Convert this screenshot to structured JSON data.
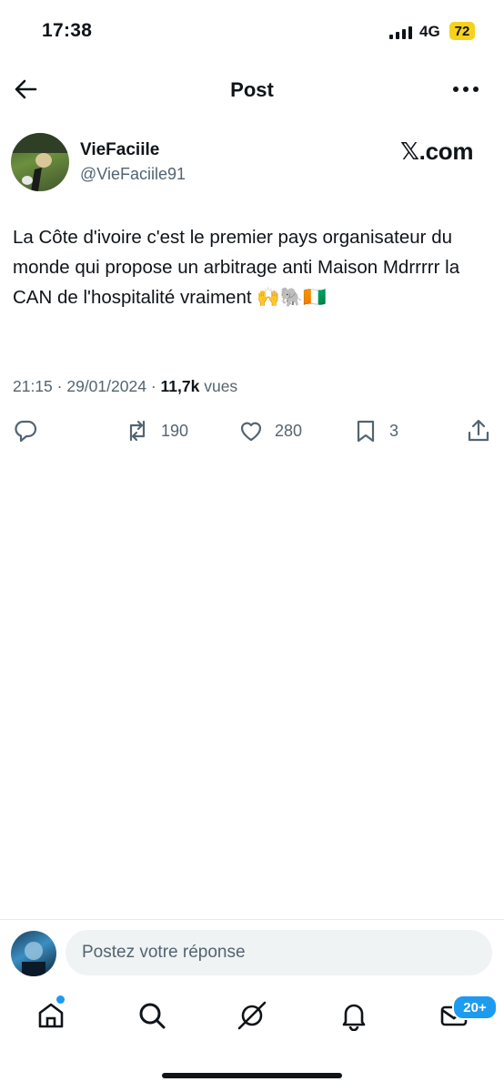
{
  "status_bar": {
    "time": "17:38",
    "network": "4G",
    "battery": "72"
  },
  "header": {
    "title": "Post"
  },
  "author": {
    "name": "VieFaciile",
    "handle": "@VieFaciile91"
  },
  "source_label": "𝕏.com",
  "tweet": {
    "text": "La Côte d'ivoire c'est le premier pays organisateur du monde qui propose un arbitrage anti Maison Mdrrrrr la CAN de l'hospitalité vraiment 🙌🐘🇨🇮",
    "time": "21:15",
    "date": "29/01/2024",
    "views": "11,7k",
    "views_label": "vues"
  },
  "actions": {
    "reposts": "190",
    "likes": "280",
    "bookmarks": "3"
  },
  "reply": {
    "placeholder": "Postez votre réponse"
  },
  "nav": {
    "messages_badge": "20+"
  },
  "colors": {
    "accent": "#1d9bf0",
    "battery": "#f7d11e",
    "secondary_text": "#536471"
  }
}
